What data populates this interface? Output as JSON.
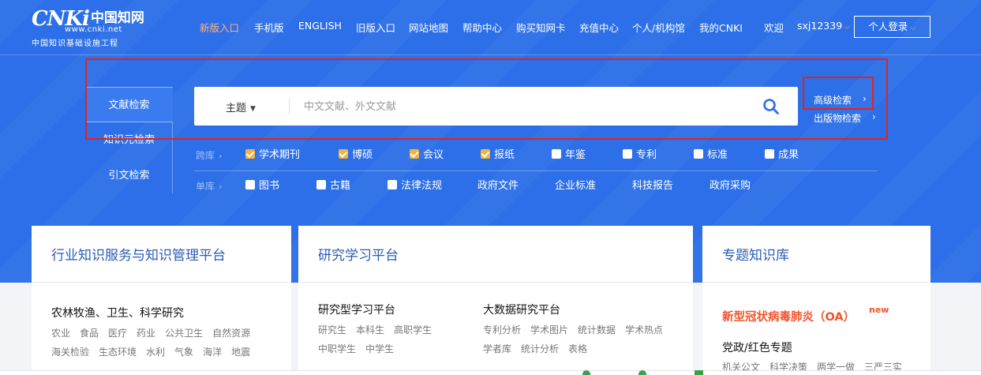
{
  "logo": {
    "brand": "CNKi",
    "brand_cn": "中国知网",
    "url": "www.cnki.net",
    "subtitle": "中国知识基础设施工程"
  },
  "nav": {
    "items": [
      "新版入口",
      "手机版",
      "ENGLISH",
      "旧版入口",
      "网站地图",
      "帮助中心",
      "购买知网卡",
      "充值中心",
      "个人/机构馆",
      "我的CNKI"
    ],
    "welcome": "欢迎",
    "username": "sxj12339",
    "login": "个人登录"
  },
  "colors": {
    "brand_blue": "#2c6fe8",
    "accent_orange": "#ff9b54",
    "highlight_red": "#e2231a",
    "checkbox_orange": "#f7b23a"
  },
  "left_tabs": [
    "文献检索",
    "知识元检索",
    "引文检索"
  ],
  "search": {
    "type": "主题",
    "placeholder": "中文文献、外文文献",
    "icon": "search-icon"
  },
  "side_links": {
    "advanced": "高级检索",
    "publication": "出版物检索"
  },
  "cross_db": {
    "label": "跨库",
    "items": [
      {
        "label": "学术期刊",
        "checked": true
      },
      {
        "label": "博硕",
        "checked": true
      },
      {
        "label": "会议",
        "checked": true
      },
      {
        "label": "报纸",
        "checked": true
      },
      {
        "label": "年鉴",
        "checked": false
      },
      {
        "label": "专利",
        "checked": false
      },
      {
        "label": "标准",
        "checked": false
      },
      {
        "label": "成果",
        "checked": false
      }
    ]
  },
  "single_db": {
    "label": "单库",
    "check_items": [
      {
        "label": "图书",
        "checked": false
      },
      {
        "label": "古籍",
        "checked": false
      },
      {
        "label": "法律法规",
        "checked": false
      }
    ],
    "link_items": [
      "政府文件",
      "企业标准",
      "科技报告",
      "政府采购"
    ]
  },
  "cards": [
    {
      "title": "行业知识服务与知识管理平台",
      "section": "农林牧渔、卫生、科学研究",
      "links_row1": [
        "农业",
        "食品",
        "医疗",
        "药业",
        "公共卫生",
        "自然资源"
      ],
      "links_row2": [
        "海关检验",
        "生态环境",
        "水利",
        "气象",
        "海洋",
        "地震"
      ]
    },
    {
      "title": "研究学习平台",
      "col1_title": "研究型学习平台",
      "col1_row1": [
        "研究生",
        "本科生",
        "高职学生"
      ],
      "col1_row2": [
        "中职学生",
        "中学生"
      ],
      "col2_title": "大数据研究平台",
      "col2_row1": [
        "专利分析",
        "学术图片",
        "统计数据",
        "学术热点"
      ],
      "col2_row2": [
        "学者库",
        "统计分析",
        "表格"
      ]
    },
    {
      "title": "专题知识库",
      "covid": "新型冠状病毒肺炎（OA）",
      "new_tag": "new",
      "section": "党政/红色专题",
      "links_row1": [
        "机关公文",
        "科学决策",
        "两学一做",
        "三严三实"
      ]
    }
  ]
}
